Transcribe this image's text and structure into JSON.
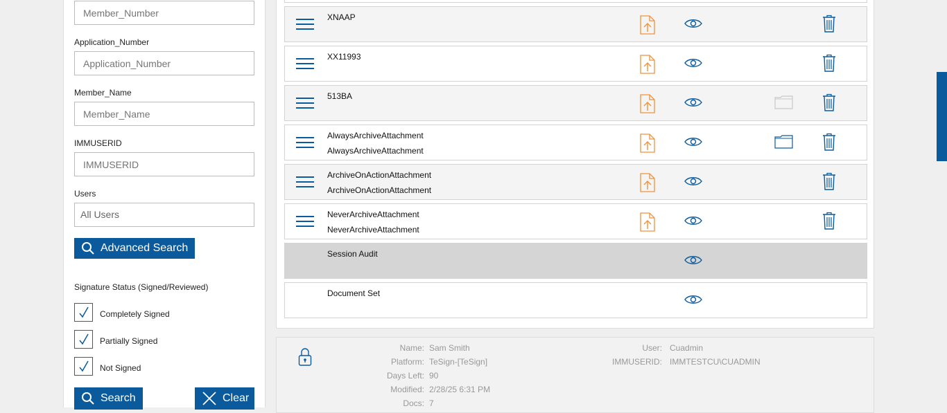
{
  "search": {
    "member_number_placeholder": "Member_Number",
    "application_number_label": "Application_Number",
    "application_number_placeholder": "Application_Number",
    "member_name_label": "Member_Name",
    "member_name_placeholder": "Member_Name",
    "immuserid_label": "IMMUSERID",
    "immuserid_placeholder": "IMMUSERID",
    "users_label": "Users",
    "users_value": "All Users",
    "advanced_search_label": "Advanced Search",
    "signature_status_label": "Signature Status (Signed/Reviewed)",
    "checkboxes": [
      {
        "label": "Completely Signed",
        "checked": true
      },
      {
        "label": "Partially Signed",
        "checked": true
      },
      {
        "label": "Not Signed",
        "checked": true
      }
    ],
    "search_label": "Search",
    "clear_label": "Clear"
  },
  "documents": [
    {
      "line1": "XNAAP",
      "line2": "",
      "upload": true,
      "folder": "none",
      "trash": true
    },
    {
      "line1": "XX11993",
      "line2": "",
      "upload": true,
      "folder": "none",
      "trash": true
    },
    {
      "line1": "513BA",
      "line2": "",
      "upload": true,
      "folder": "gray",
      "trash": true
    },
    {
      "line1": "AlwaysArchiveAttachment",
      "line2": "AlwaysArchiveAttachment",
      "upload": true,
      "folder": "blue",
      "trash": true
    },
    {
      "line1": "ArchiveOnActionAttachment",
      "line2": "ArchiveOnActionAttachment",
      "upload": true,
      "folder": "none",
      "trash": true
    },
    {
      "line1": "NeverArchiveAttachment",
      "line2": "NeverArchiveAttachment",
      "upload": true,
      "folder": "none",
      "trash": true
    },
    {
      "line1": "Session Audit",
      "line2": "",
      "upload": false,
      "folder": "none",
      "trash": false
    },
    {
      "line1": "Document Set",
      "line2": "",
      "upload": false,
      "folder": "none",
      "trash": false
    }
  ],
  "info": {
    "name_label": "Name:",
    "name_value": "Sam Smith",
    "platform_label": "Platform:",
    "platform_value": "TeSign-[TeSign]",
    "days_left_label": "Days Left:",
    "days_left_value": "90",
    "modified_label": "Modified:",
    "modified_value": "2/28/25 6:31 PM",
    "docs_label": "Docs:",
    "docs_value": "7",
    "user_label": "User:",
    "user_value": "Cuadmin",
    "immuserid_label": "IMMUSERID:",
    "immuserid_value": "IMMTESTCU\\CUADMIN"
  },
  "colors": {
    "accent": "#0a5a9c",
    "upload": "#f0923a"
  }
}
